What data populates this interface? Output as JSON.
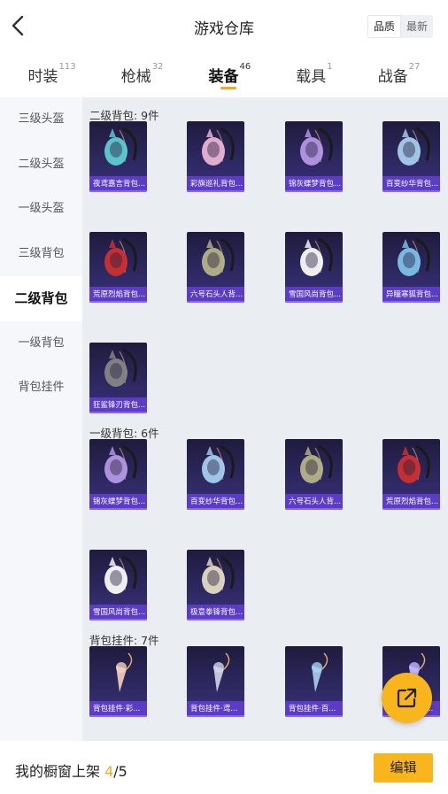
{
  "header": {
    "title": "游戏仓库",
    "sort_options": [
      {
        "label": "品质",
        "active": true
      },
      {
        "label": "最新",
        "active": false
      }
    ]
  },
  "tabs": [
    {
      "label": "时装",
      "count": "113",
      "active": false
    },
    {
      "label": "枪械",
      "count": "32",
      "active": false
    },
    {
      "label": "装备",
      "count": "46",
      "active": true
    },
    {
      "label": "载具",
      "count": "1",
      "active": false
    },
    {
      "label": "战备",
      "count": "27",
      "active": false
    }
  ],
  "sidebar": {
    "items": [
      {
        "label": "三级头盔",
        "active": false
      },
      {
        "label": "二级头盔",
        "active": false
      },
      {
        "label": "一级头盔",
        "active": false
      },
      {
        "label": "三级背包",
        "active": false
      },
      {
        "label": "二级背包",
        "active": true
      },
      {
        "label": "一级背包",
        "active": false
      },
      {
        "label": "背包挂件",
        "active": false
      }
    ]
  },
  "sections": [
    {
      "title": "二级背包: 9件",
      "items": [
        {
          "label": "夜鸢嘉言背包...",
          "icon": "dark-backpack-icon",
          "accent": "#5fd0d6"
        },
        {
          "label": "彩旗巡礼背包...",
          "icon": "pink-backpack-icon",
          "accent": "#f0b8d8"
        },
        {
          "label": "锦灰蝶梦背包...",
          "icon": "diamond-backpack-icon",
          "accent": "#b89ae8"
        },
        {
          "label": "百变纱华背包...",
          "icon": "crystal-backpack-icon",
          "accent": "#a9d2f2"
        },
        {
          "label": "荒原烈焰背包...",
          "icon": "red-mask-backpack-icon",
          "accent": "#d23030"
        },
        {
          "label": "六号石头人背...",
          "icon": "stone-golem-backpack-icon",
          "accent": "#b8b78a"
        },
        {
          "label": "雪国风尚背包...",
          "icon": "bunny-backpack-icon",
          "accent": "#ffffff"
        },
        {
          "label": "异瞳寒狐背包...",
          "icon": "fox-backpack-icon",
          "accent": "#7fc6ef"
        },
        {
          "label": "狂鲨锋刃背包...",
          "icon": "shark-backpack-icon",
          "accent": "#888888"
        }
      ]
    },
    {
      "title": "一级背包: 6件",
      "items": [
        {
          "label": "锦灰蝶梦背包...",
          "icon": "diamond-backpack-icon",
          "accent": "#b89ae8"
        },
        {
          "label": "百变纱华背包...",
          "icon": "crystal-backpack-icon",
          "accent": "#a9d2f2"
        },
        {
          "label": "六号石头人背...",
          "icon": "stone-golem-backpack-icon",
          "accent": "#b8b78a"
        },
        {
          "label": "荒原烈焰背包...",
          "icon": "red-mask-backpack-icon",
          "accent": "#d23030"
        },
        {
          "label": "雪国风尚背包...",
          "icon": "bunny-backpack-icon",
          "accent": "#ffffff"
        },
        {
          "label": "极意拳锋背包...",
          "icon": "cup-backpack-icon",
          "accent": "#e8e0c8"
        }
      ]
    },
    {
      "title": "背包挂件: 7件",
      "items": [
        {
          "label": "背包挂件·彩...",
          "icon": "ice-cream-charm-icon",
          "accent": "#f2d2c0"
        },
        {
          "label": "背包挂件·鸢...",
          "icon": "blade-charm-icon",
          "accent": "#d0d6e8"
        },
        {
          "label": "背包挂件·百...",
          "icon": "crystal-charm-icon",
          "accent": "#a9d2f2"
        },
        {
          "label": "背包挂件·你...",
          "icon": "charm-icon",
          "accent": "#c4b5ff"
        }
      ]
    }
  ],
  "footer": {
    "prefix": "我的橱窗上架 ",
    "current": "4",
    "total": "/5",
    "edit_label": "编辑"
  },
  "colors": {
    "accent": "#f8b51c",
    "item_label_bg": "#5b3cc4",
    "content_bg": "#eaedf2"
  },
  "icons": {
    "back": "chevron-left-icon",
    "share": "share-external-icon"
  }
}
